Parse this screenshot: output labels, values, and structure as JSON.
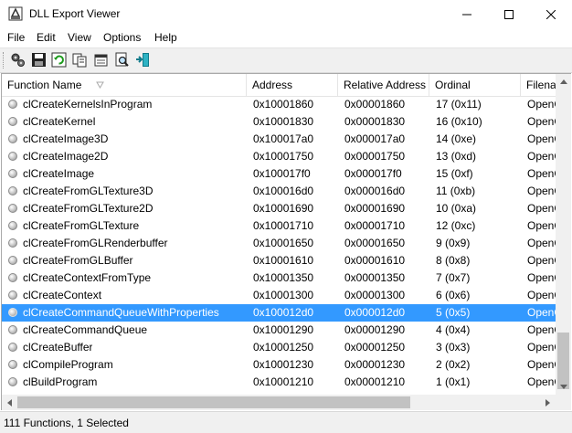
{
  "window": {
    "title": "DLL Export Viewer"
  },
  "menu": [
    "File",
    "Edit",
    "View",
    "Options",
    "Help"
  ],
  "toolbar": {
    "icons": [
      "options-icon",
      "save-icon",
      "refresh-icon",
      "copy-icon",
      "properties-icon",
      "find-icon",
      "exit-icon"
    ]
  },
  "table": {
    "columns": [
      "Function Name",
      "Address",
      "Relative Address",
      "Ordinal",
      "Filena"
    ],
    "rows": [
      {
        "name": "clCreateKernelsInProgram",
        "address": "0x10001860",
        "relative": "0x00001860",
        "ordinal": "17 (0x11)",
        "file": "OpenC"
      },
      {
        "name": "clCreateKernel",
        "address": "0x10001830",
        "relative": "0x00001830",
        "ordinal": "16 (0x10)",
        "file": "OpenC"
      },
      {
        "name": "clCreateImage3D",
        "address": "0x100017a0",
        "relative": "0x000017a0",
        "ordinal": "14 (0xe)",
        "file": "OpenC"
      },
      {
        "name": "clCreateImage2D",
        "address": "0x10001750",
        "relative": "0x00001750",
        "ordinal": "13 (0xd)",
        "file": "OpenC"
      },
      {
        "name": "clCreateImage",
        "address": "0x100017f0",
        "relative": "0x000017f0",
        "ordinal": "15 (0xf)",
        "file": "OpenC"
      },
      {
        "name": "clCreateFromGLTexture3D",
        "address": "0x100016d0",
        "relative": "0x000016d0",
        "ordinal": "11 (0xb)",
        "file": "OpenC"
      },
      {
        "name": "clCreateFromGLTexture2D",
        "address": "0x10001690",
        "relative": "0x00001690",
        "ordinal": "10 (0xa)",
        "file": "OpenC"
      },
      {
        "name": "clCreateFromGLTexture",
        "address": "0x10001710",
        "relative": "0x00001710",
        "ordinal": "12 (0xc)",
        "file": "OpenC"
      },
      {
        "name": "clCreateFromGLRenderbuffer",
        "address": "0x10001650",
        "relative": "0x00001650",
        "ordinal": "9 (0x9)",
        "file": "OpenC"
      },
      {
        "name": "clCreateFromGLBuffer",
        "address": "0x10001610",
        "relative": "0x00001610",
        "ordinal": "8 (0x8)",
        "file": "OpenC"
      },
      {
        "name": "clCreateContextFromType",
        "address": "0x10001350",
        "relative": "0x00001350",
        "ordinal": "7 (0x7)",
        "file": "OpenC"
      },
      {
        "name": "clCreateContext",
        "address": "0x10001300",
        "relative": "0x00001300",
        "ordinal": "6 (0x6)",
        "file": "OpenC"
      },
      {
        "name": "clCreateCommandQueueWithProperties",
        "address": "0x100012d0",
        "relative": "0x000012d0",
        "ordinal": "5 (0x5)",
        "file": "OpenC",
        "selected": true
      },
      {
        "name": "clCreateCommandQueue",
        "address": "0x10001290",
        "relative": "0x00001290",
        "ordinal": "4 (0x4)",
        "file": "OpenC"
      },
      {
        "name": "clCreateBuffer",
        "address": "0x10001250",
        "relative": "0x00001250",
        "ordinal": "3 (0x3)",
        "file": "OpenC"
      },
      {
        "name": "clCompileProgram",
        "address": "0x10001230",
        "relative": "0x00001230",
        "ordinal": "2 (0x2)",
        "file": "OpenC"
      },
      {
        "name": "clBuildProgram",
        "address": "0x10001210",
        "relative": "0x00001210",
        "ordinal": "1 (0x1)",
        "file": "OpenC"
      }
    ]
  },
  "status": {
    "text": "111 Functions, 1 Selected"
  },
  "colors": {
    "selection": "#3399ff",
    "toolbar_bg": "#f0f0f0"
  }
}
